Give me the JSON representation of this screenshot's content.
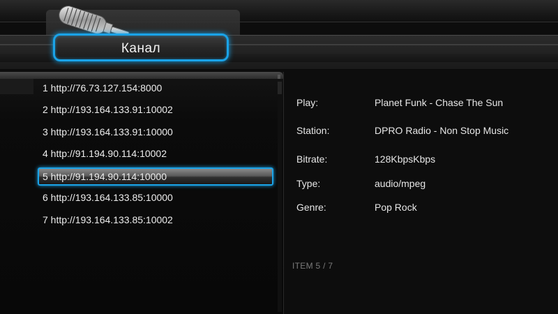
{
  "header": {
    "title": "Канал",
    "icon": "microphone-icon"
  },
  "channels": [
    {
      "label": "1 http://76.73.127.154:8000",
      "selected": false
    },
    {
      "label": "2 http://193.164.133.91:10002",
      "selected": false
    },
    {
      "label": "3 http://193.164.133.91:10000",
      "selected": false
    },
    {
      "label": "4 http://91.194.90.114:10002",
      "selected": false
    },
    {
      "label": "5 http://91.194.90.114:10000",
      "selected": true
    },
    {
      "label": "6 http://193.164.133.85:10000",
      "selected": false
    },
    {
      "label": "7 http://193.164.133.85:10002",
      "selected": false
    }
  ],
  "details": {
    "play": {
      "label": "Play:",
      "value": "Planet Funk - Chase The Sun"
    },
    "station": {
      "label": "Station:",
      "value": "DPRO Radio - Non Stop Music"
    },
    "bitrate": {
      "label": "Bitrate:",
      "value": "128KbpsKbps"
    },
    "type": {
      "label": "Type:",
      "value": "audio/mpeg"
    },
    "genre": {
      "label": "Genre:",
      "value": "Pop Rock"
    }
  },
  "counter": "ITEM 5 / 7",
  "colors": {
    "accent": "#1aa3e8",
    "background": "#0d0d0d",
    "text": "#e8e8e8",
    "muted": "#7a7a7a"
  }
}
